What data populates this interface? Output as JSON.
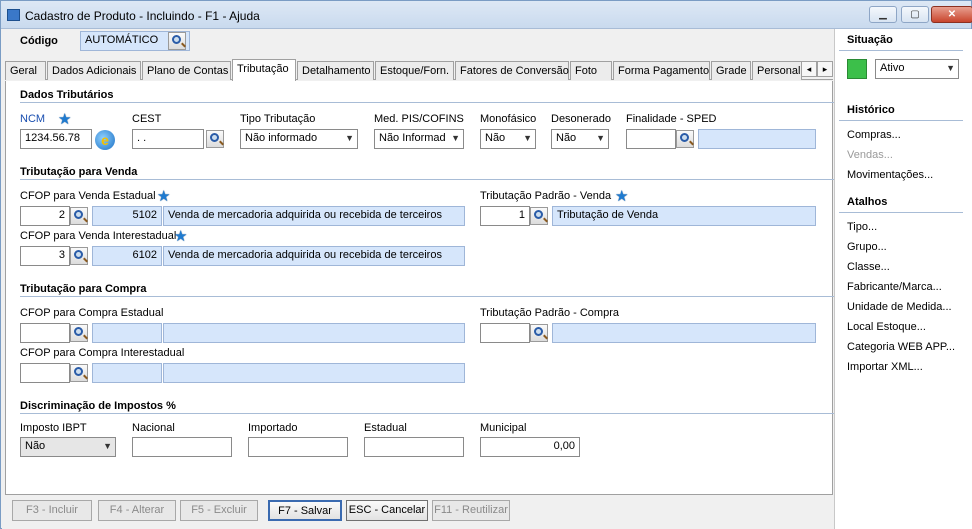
{
  "window": {
    "title": "Cadastro de Produto - Incluindo - F1 - Ajuda",
    "minimize_icon": "minimize-icon",
    "maximize_icon": "maximize-icon",
    "close_icon": "close-icon"
  },
  "header": {
    "codigo_label": "Código",
    "codigo_value": "AUTOMÁTICO"
  },
  "tabs": [
    {
      "label": "Geral"
    },
    {
      "label": "Dados Adicionais"
    },
    {
      "label": "Plano de Contas"
    },
    {
      "label": "Tributação",
      "active": true
    },
    {
      "label": "Detalhamento"
    },
    {
      "label": "Estoque/Forn."
    },
    {
      "label": "Fatores de Conversão"
    },
    {
      "label": "Foto"
    },
    {
      "label": "Forma Pagamento"
    },
    {
      "label": "Grade"
    },
    {
      "label": "Personaliz"
    }
  ],
  "dados_tributarios": {
    "section_title": "Dados Tributários",
    "ncm_label": "NCM",
    "ncm_value": "1234.56.78",
    "cest_label": "CEST",
    "cest_value": ". .",
    "tipo_tributacao_label": "Tipo Tributação",
    "tipo_tributacao_value": "Não informado",
    "med_pis_label": "Med. PIS/COFINS",
    "med_pis_value": "Não Informad",
    "monofasico_label": "Monofásico",
    "monofasico_value": "Não",
    "desonerado_label": "Desonerado",
    "desonerado_value": "Não",
    "finalidade_label": "Finalidade - SPED",
    "finalidade_value": "",
    "finalidade_desc": ""
  },
  "tributacao_venda": {
    "section_title": "Tributação para Venda",
    "cfop_estadual_label": "CFOP para Venda Estadual",
    "cfop_estadual_id": "2",
    "cfop_estadual_code": "5102",
    "cfop_estadual_desc": "Venda de mercadoria adquirida ou recebida de terceiros",
    "cfop_interestadual_label": "CFOP para Venda Interestadual",
    "cfop_interestadual_id": "3",
    "cfop_interestadual_code": "6102",
    "cfop_interestadual_desc": "Venda de mercadoria adquirida ou recebida de terceiros",
    "padrao_label": "Tributação Padrão - Venda",
    "padrao_id": "1",
    "padrao_desc": "Tributação de Venda"
  },
  "tributacao_compra": {
    "section_title": "Tributação para Compra",
    "cfop_estadual_label": "CFOP para Compra Estadual",
    "cfop_interestadual_label": "CFOP para Compra Interestadual",
    "padrao_label": "Tributação Padrão - Compra"
  },
  "impostos": {
    "section_title": "Discriminação de Impostos %",
    "ibpt_label": "Imposto IBPT",
    "ibpt_value": "Não",
    "nacional_label": "Nacional",
    "nacional_value": "",
    "importado_label": "Importado",
    "importado_value": "",
    "estadual_label": "Estadual",
    "estadual_value": "",
    "municipal_label": "Municipal",
    "municipal_value": "0,00"
  },
  "buttons": {
    "incluir": "F3 - Incluir",
    "alterar": "F4 - Alterar",
    "excluir": "F5 - Excluir",
    "salvar": "F7 - Salvar",
    "cancelar": "ESC - Cancelar",
    "reutilizar": "F11 - Reutilizar"
  },
  "sidebar": {
    "situacao_title": "Situação",
    "situacao_value": "Ativo",
    "situacao_color": "#3cbf4a",
    "historico_title": "Histórico",
    "historico_items": [
      "Compras...",
      "Vendas...",
      "Movimentações..."
    ],
    "atalhos_title": "Atalhos",
    "atalhos_items": [
      "Tipo...",
      "Grupo...",
      "Classe...",
      "Fabricante/Marca...",
      "Unidade de Medida...",
      "Local Estoque...",
      "Categoria WEB APP...",
      "Importar XML..."
    ]
  }
}
